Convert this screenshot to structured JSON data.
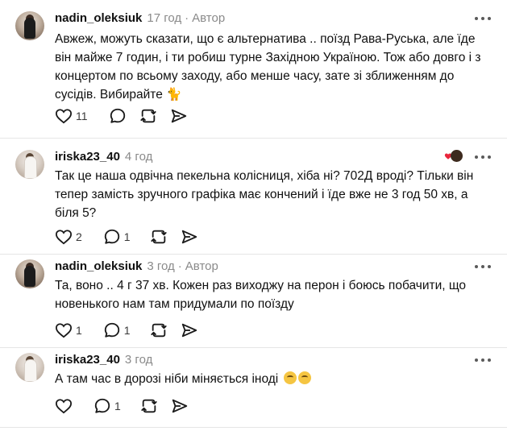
{
  "comments": [
    {
      "user": "nadin_oleksiuk",
      "time": "17 год",
      "author_label": "Автор",
      "text": "Авжеж, можуть сказати, що є альтернатива .. поїзд Рава-Руська, але їде він майже 7 годин, і ти робиш турне Західною Україною. Тож або довго і з концертом по всьому заходу, або менше часу, зате зі зближенням до сусідів. Вибирайте",
      "likes": "11",
      "replies": ""
    },
    {
      "user": "iriska23_40",
      "time": "4 год",
      "text": "Так це наша одвічна пекельна колісниця, хіба ні? 702Д вроді? Тільки він тепер замість зручного графіка має кончений і їде вже не 3 год 50 хв, а біля 5?",
      "likes": "2",
      "replies": "1"
    },
    {
      "user": "nadin_oleksiuk",
      "time": "3 год",
      "author_label": "Автор",
      "text": "Та, воно .. 4 г 37 хв. Кожен раз виходжу на перон і боюсь побачити, що новенького нам там придумали по поїзду",
      "likes": "1",
      "replies": "1"
    },
    {
      "user": "iriska23_40",
      "time": "3 год",
      "text": "А там час в дорозі ніби міняється іноді",
      "likes": "",
      "replies": "1"
    }
  ],
  "icons": {
    "like": "heart-icon",
    "reply": "comment-icon",
    "repost": "repost-icon",
    "share": "send-icon",
    "more": "more-icon"
  },
  "colors": {
    "text": "#101010",
    "muted": "#8a8a8a",
    "divider": "#e6e6e6"
  }
}
